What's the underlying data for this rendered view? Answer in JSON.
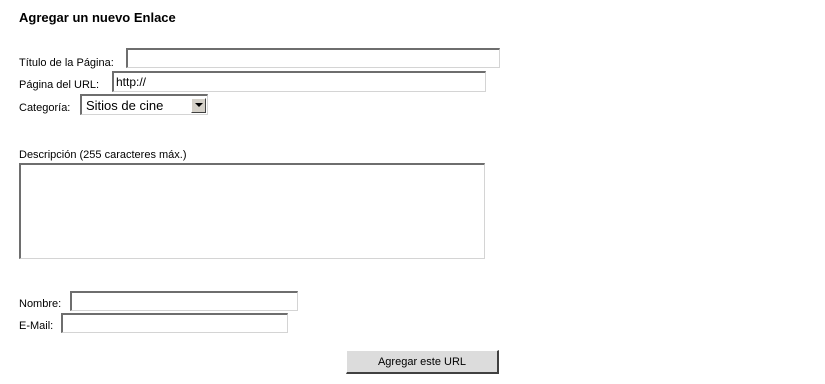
{
  "form": {
    "title": "Agregar un nuevo Enlace",
    "fields": {
      "page_title": {
        "label": "Título de la Página:",
        "value": ""
      },
      "url": {
        "label": "Página del URL:",
        "value": "http://"
      },
      "category": {
        "label": "Categoría:",
        "selected": "Sitios de cine"
      },
      "description": {
        "label": "Descripción (255 caracteres máx.)",
        "value": ""
      },
      "name": {
        "label": "Nombre:",
        "value": ""
      },
      "email": {
        "label": "E-Mail:",
        "value": ""
      }
    },
    "submit_label": "Agregar este URL"
  },
  "icons": {
    "select_arrow": "chevron-down-icon"
  }
}
